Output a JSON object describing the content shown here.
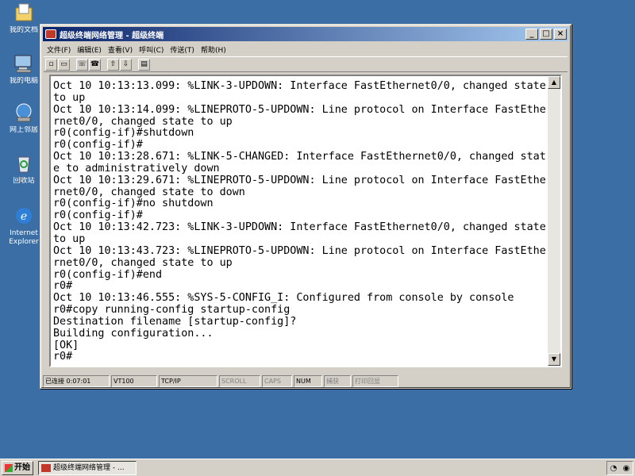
{
  "desktop": {
    "icons": [
      {
        "label": "我的文档",
        "icon": "my-documents-icon"
      },
      {
        "label": "我的电脑",
        "icon": "my-computer-icon"
      },
      {
        "label": "网上邻居",
        "icon": "network-icon"
      },
      {
        "label": "回收站",
        "icon": "recycle-bin-icon"
      },
      {
        "label": "Internet Explorer",
        "icon": "internet-explorer-icon"
      }
    ]
  },
  "window": {
    "title": "超级终端网络管理 - 超级终端",
    "controls": {
      "minimize": "_",
      "maximize": "□",
      "close": "×"
    },
    "menu": [
      "文件(F)",
      "编辑(E)",
      "查看(V)",
      "呼叫(C)",
      "传送(T)",
      "帮助(H)"
    ],
    "toolbar": [
      "new-icon",
      "open-icon",
      "disconnect-icon",
      "call-icon",
      "send-icon",
      "receive-icon",
      "properties-icon"
    ],
    "terminal_text": "Oct 10 10:13:13.099: %LINK-3-UPDOWN: Interface FastEthernet0/0, changed state to up\nOct 10 10:13:14.099: %LINEPROTO-5-UPDOWN: Line protocol on Interface FastEthernet0/0, changed state to up\nr0(config-if)#shutdown\nr0(config-if)#\nOct 10 10:13:28.671: %LINK-5-CHANGED: Interface FastEthernet0/0, changed state to administratively down\nOct 10 10:13:29.671: %LINEPROTO-5-UPDOWN: Line protocol on Interface FastEthernet0/0, changed state to down\nr0(config-if)#no shutdown\nr0(config-if)#\nOct 10 10:13:42.723: %LINK-3-UPDOWN: Interface FastEthernet0/0, changed state to up\nOct 10 10:13:43.723: %LINEPROTO-5-UPDOWN: Line protocol on Interface FastEthernet0/0, changed state to up\nr0(config-if)#end\nr0#\nOct 10 10:13:46.555: %SYS-5-CONFIG_I: Configured from console by console\nr0#copy running-config startup-config\nDestination filename [startup-config]?\nBuilding configuration...\n[OK]\nr0#",
    "status": {
      "connected": "已连接 0:07:01",
      "emulation": "VT100",
      "protocol": "TCP/IP",
      "scroll": "SCROLL",
      "caps": "CAPS",
      "num": "NUM",
      "capture": "捕获",
      "print_echo": "打印回显"
    }
  },
  "taskbar": {
    "start_label": "开始",
    "task_label": "超级终端网络管理 - ..."
  }
}
